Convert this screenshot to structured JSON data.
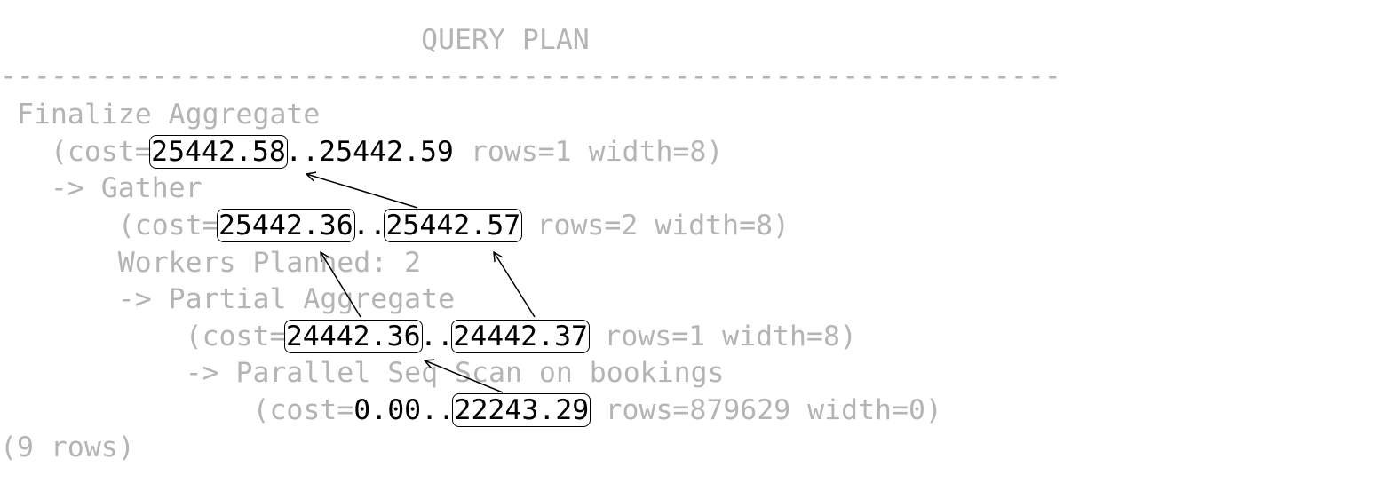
{
  "header": {
    "title": "QUERY PLAN",
    "separator": "---------------------------------------------------------------"
  },
  "plan": {
    "finalize": {
      "node": "Finalize Aggregate",
      "cost_prefix": "(cost=",
      "startup_cost": "25442.58",
      "dots": "..",
      "total_cost": "25442.59",
      "rows": "rows=1",
      "width": "width=8)"
    },
    "gather": {
      "node": "-> Gather",
      "cost_prefix": "(cost=",
      "startup_cost": "25442.36",
      "dots": "..",
      "total_cost": "25442.57",
      "rows": "rows=2",
      "width": "width=8)",
      "workers": "Workers Planned: 2"
    },
    "partial": {
      "node": "-> Partial Aggregate",
      "cost_prefix": "(cost=",
      "startup_cost": "24442.36",
      "dots": "..",
      "total_cost": "24442.37",
      "rows": "rows=1",
      "width": "width=8)"
    },
    "scan": {
      "node": "-> Parallel Seq Scan on bookings",
      "cost_prefix": "(cost=",
      "startup_cost": "0.00",
      "dots": "..",
      "total_cost": "22243.29",
      "rows": "rows=879629",
      "width": "width=0)"
    }
  },
  "footer": {
    "row_count": "(9 rows)"
  },
  "colors": {
    "dim_text": "#b4b4b4",
    "highlight_text": "#000000",
    "background": "#ffffff"
  }
}
